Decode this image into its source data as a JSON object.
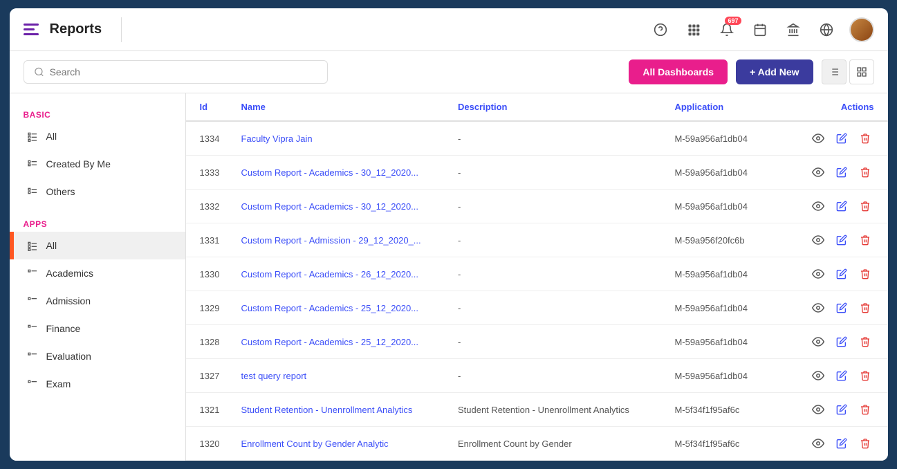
{
  "header": {
    "title": "Reports",
    "notification_count": "697"
  },
  "toolbar": {
    "search_placeholder": "Search",
    "btn_all_dashboards": "All Dashboards",
    "btn_add_new": "+ Add New"
  },
  "sidebar": {
    "basic_label": "BASIC",
    "apps_label": "APPS",
    "basic_items": [
      {
        "id": "all",
        "label": "All",
        "active": false
      },
      {
        "id": "created-by-me",
        "label": "Created By Me",
        "active": false
      },
      {
        "id": "others",
        "label": "Others",
        "active": false
      }
    ],
    "apps_items": [
      {
        "id": "all",
        "label": "All",
        "active": true
      },
      {
        "id": "academics",
        "label": "Academics",
        "active": false
      },
      {
        "id": "admission",
        "label": "Admission",
        "active": false
      },
      {
        "id": "finance",
        "label": "Finance",
        "active": false
      },
      {
        "id": "evaluation",
        "label": "Evaluation",
        "active": false
      },
      {
        "id": "exam",
        "label": "Exam",
        "active": false
      }
    ]
  },
  "table": {
    "columns": {
      "id": "Id",
      "name": "Name",
      "description": "Description",
      "application": "Application",
      "actions": "Actions"
    },
    "rows": [
      {
        "id": "1334",
        "name": "Faculty Vipra Jain",
        "description": "-",
        "application": "M-59a956af1db04"
      },
      {
        "id": "1333",
        "name": "Custom Report - Academics - 30_12_2020...",
        "description": "-",
        "application": "M-59a956af1db04"
      },
      {
        "id": "1332",
        "name": "Custom Report - Academics - 30_12_2020...",
        "description": "-",
        "application": "M-59a956af1db04"
      },
      {
        "id": "1331",
        "name": "Custom Report - Admission - 29_12_2020_...",
        "description": "-",
        "application": "M-59a956f20fc6b"
      },
      {
        "id": "1330",
        "name": "Custom Report - Academics - 26_12_2020...",
        "description": "-",
        "application": "M-59a956af1db04"
      },
      {
        "id": "1329",
        "name": "Custom Report - Academics - 25_12_2020...",
        "description": "-",
        "application": "M-59a956af1db04"
      },
      {
        "id": "1328",
        "name": "Custom Report - Academics - 25_12_2020...",
        "description": "-",
        "application": "M-59a956af1db04"
      },
      {
        "id": "1327",
        "name": "test query report",
        "description": "-",
        "application": "M-59a956af1db04"
      },
      {
        "id": "1321",
        "name": "Student Retention - Unenrollment Analytics",
        "description": "Student Retention - Unenrollment Analytics",
        "application": "M-5f34f1f95af6c"
      },
      {
        "id": "1320",
        "name": "Enrollment Count by Gender Analytic",
        "description": "Enrollment Count by Gender",
        "application": "M-5f34f1f95af6c"
      }
    ]
  }
}
